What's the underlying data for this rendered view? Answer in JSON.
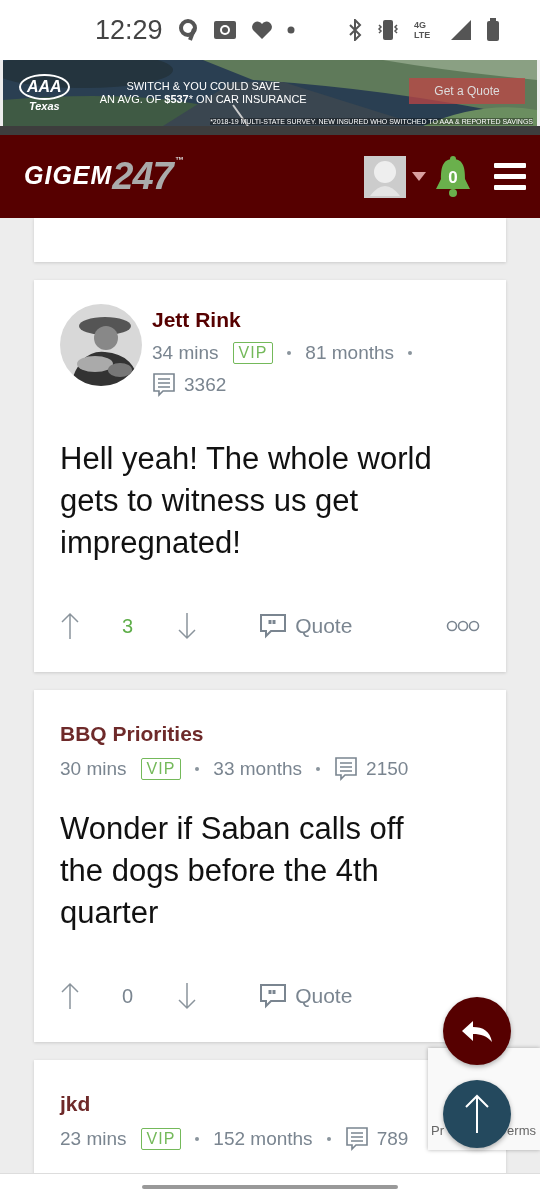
{
  "status_bar": {
    "time": "12:29",
    "network": "4G LTE"
  },
  "ad": {
    "brand": "AAA",
    "region": "Texas",
    "line_1": "SWITCH & YOU COULD SAVE",
    "line_2": "AN AVG. OF **$537*** ON CAR INSURANCE",
    "button": "Get a Quote",
    "fine_print": "*2018-19 MULTI-STATE SURVEY. NEW INSURED WHO SWITCHED TO AAA & REPORTED SAVINGS"
  },
  "header": {
    "logo_word": "GIGEM",
    "logo_number": "247",
    "trademark": "™",
    "notifications": "0"
  },
  "posts": [
    {
      "author": "Jett Rink",
      "has_avatar": true,
      "time": "34 mins",
      "badge": "VIP",
      "tenure": "81 months",
      "post_count": "3362",
      "body": "Hell yeah! The whole world gets to witness us get impregnated!",
      "score": "3",
      "score_positive": true,
      "more_menu": true,
      "quote": "Quote"
    },
    {
      "author": "BBQ Priorities",
      "has_avatar": false,
      "time": "30 mins",
      "badge": "VIP",
      "tenure": "33 months",
      "post_count": "2150",
      "body": "Wonder if Saban calls off the dogs before the 4th quarter",
      "score": "0",
      "score_positive": false,
      "quote": "Quote"
    },
    {
      "author": "jkd",
      "has_avatar": false,
      "time": "23 mins",
      "badge": "VIP",
      "tenure": "152 months",
      "post_count": "789"
    }
  ],
  "recaptcha": {
    "left": "Pr",
    "right": "erms"
  }
}
